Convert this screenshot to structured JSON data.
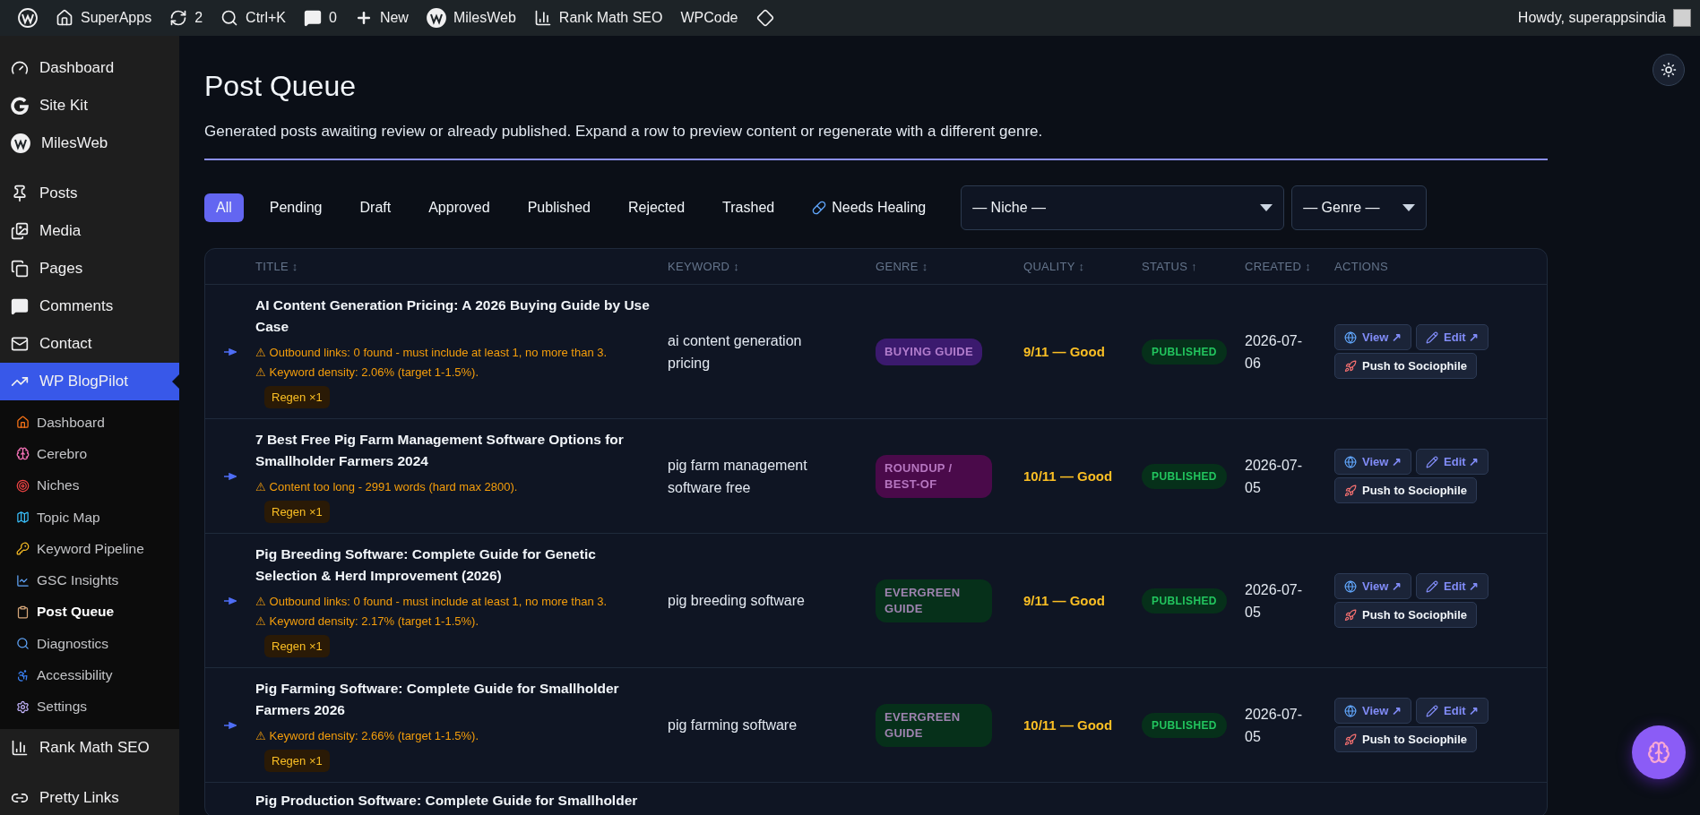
{
  "admin_bar": {
    "items": [
      {
        "kind": "wp"
      },
      {
        "kind": "home",
        "label": "SuperApps"
      },
      {
        "kind": "updates",
        "label": "2"
      },
      {
        "kind": "search",
        "label": "Ctrl+K"
      },
      {
        "kind": "comments",
        "label": "0"
      },
      {
        "kind": "new",
        "label": "New"
      },
      {
        "kind": "milesweb",
        "label": "MilesWeb"
      },
      {
        "kind": "rankmath",
        "label": "Rank Math SEO"
      },
      {
        "kind": "text",
        "label": "WPCode"
      },
      {
        "kind": "diamond"
      }
    ],
    "greeting": "Howdy, superappsindia"
  },
  "sidebar": {
    "groups": [
      [
        {
          "kind": "dashboard",
          "label": "Dashboard",
          "selected": false
        },
        {
          "kind": "sitekit",
          "label": "Site Kit",
          "selected": false
        },
        {
          "kind": "milesweb",
          "label": "MilesWeb",
          "selected": false
        }
      ],
      [
        {
          "kind": "posts",
          "label": "Posts",
          "selected": false
        },
        {
          "kind": "media",
          "label": "Media",
          "selected": false
        },
        {
          "kind": "pages",
          "label": "Pages",
          "selected": false
        },
        {
          "kind": "comments",
          "label": "Comments",
          "selected": false
        },
        {
          "kind": "contact",
          "label": "Contact",
          "selected": false
        },
        {
          "kind": "blogpilot",
          "label": "WP BlogPilot",
          "selected": true,
          "submenu": [
            {
              "kind": "home",
              "label": "Dashboard",
              "selected": false
            },
            {
              "kind": "brain",
              "label": "Cerebro",
              "selected": false
            },
            {
              "kind": "target",
              "label": "Niches",
              "selected": false
            },
            {
              "kind": "map",
              "label": "Topic Map",
              "selected": false
            },
            {
              "kind": "key",
              "label": "Keyword Pipeline",
              "selected": false
            },
            {
              "kind": "chart",
              "label": "GSC Insights",
              "selected": false
            },
            {
              "kind": "clipboard",
              "label": "Post Queue",
              "selected": true
            },
            {
              "kind": "search",
              "label": "Diagnostics",
              "selected": false
            },
            {
              "kind": "accessibility",
              "label": "Accessibility",
              "selected": false
            },
            {
              "kind": "settings",
              "label": "Settings",
              "selected": false
            }
          ]
        },
        {
          "kind": "rankmath",
          "label": "Rank Math SEO",
          "selected": false
        }
      ],
      [
        {
          "kind": "prettylinks",
          "label": "Pretty Links",
          "selected": false
        }
      ]
    ]
  },
  "page": {
    "title": "Post Queue",
    "description": "Generated posts awaiting review or already published. Expand a row to preview content or regenerate with a different genre."
  },
  "filters": [
    {
      "kind": "plain",
      "label": "All",
      "selected": true
    },
    {
      "kind": "plain",
      "label": "Pending",
      "selected": false
    },
    {
      "kind": "plain",
      "label": "Draft",
      "selected": false
    },
    {
      "kind": "plain",
      "label": "Approved",
      "selected": false
    },
    {
      "kind": "plain",
      "label": "Published",
      "selected": false
    },
    {
      "kind": "plain",
      "label": "Rejected",
      "selected": false
    },
    {
      "kind": "plain",
      "label": "Trashed",
      "selected": false
    },
    {
      "kind": "healing",
      "label": "Needs Healing",
      "selected": false
    }
  ],
  "selects": [
    {
      "kind": "wide",
      "value": "— Niche —"
    },
    {
      "kind": "narrow",
      "value": "— Genre —"
    }
  ],
  "table": {
    "columns": [
      {
        "label": "TITLE",
        "sort": "↕"
      },
      {
        "label": "KEYWORD",
        "sort": "↕"
      },
      {
        "label": "GENRE",
        "sort": "↕"
      },
      {
        "label": "QUALITY",
        "sort": "↕"
      },
      {
        "label": "STATUS",
        "sort": "↑"
      },
      {
        "label": "CREATED",
        "sort": "↕"
      },
      {
        "label": "ACTIONS"
      }
    ],
    "rows": [
      {
        "kind": "full",
        "title": "AI Content Generation Pricing: A 2026 Buying Guide by Use Case",
        "warnings": [
          "⚠ Outbound links: 0 found - must include at least 1, no more than 3.",
          "⚠ Keyword density: 2.06% (target 1-1.5%)."
        ],
        "regen": "Regen ×1",
        "keyword": "ai content generation pricing",
        "genre": {
          "label": "BUYING GUIDE",
          "color": "#3b1a6e"
        },
        "quality": "9/11 — Good",
        "status": "PUBLISHED",
        "created": "2026-07-06",
        "actions": [
          {
            "kind": "view",
            "label": "View ↗"
          },
          {
            "kind": "edit",
            "label": "Edit ↗"
          },
          {
            "kind": "push",
            "label": "Push to Sociophile"
          }
        ]
      },
      {
        "kind": "full",
        "title": "7 Best Free Pig Farm Management Software Options for Smallholder Farmers 2024",
        "warnings": [
          "⚠ Content too long - 2991 words (hard max 2800)."
        ],
        "regen": "Regen ×1",
        "keyword": "pig farm management software free",
        "genre": {
          "label": "ROUNDUP / BEST-OF",
          "color": "#4a0a4a"
        },
        "quality": "10/11 — Good",
        "status": "PUBLISHED",
        "created": "2026-07-05",
        "actions": [
          {
            "kind": "view",
            "label": "View ↗"
          },
          {
            "kind": "edit",
            "label": "Edit ↗"
          },
          {
            "kind": "push",
            "label": "Push to Sociophile"
          }
        ]
      },
      {
        "kind": "full",
        "title": "Pig Breeding Software: Complete Guide for Genetic Selection & Herd Improvement (2026)",
        "warnings": [
          "⚠ Outbound links: 0 found - must include at least 1, no more than 3.",
          "⚠ Keyword density: 2.17% (target 1-1.5%)."
        ],
        "regen": "Regen ×1",
        "keyword": "pig breeding software",
        "genre": {
          "label": "EVERGREEN GUIDE",
          "color": "#06301a"
        },
        "quality": "9/11 — Good",
        "status": "PUBLISHED",
        "created": "2026-07-05",
        "actions": [
          {
            "kind": "view",
            "label": "View ↗"
          },
          {
            "kind": "edit",
            "label": "Edit ↗"
          },
          {
            "kind": "push",
            "label": "Push to Sociophile"
          }
        ]
      },
      {
        "kind": "full",
        "title": "Pig Farming Software: Complete Guide for Smallholder Farmers 2026",
        "warnings": [
          "⚠ Keyword density: 2.66% (target 1-1.5%)."
        ],
        "regen": "Regen ×1",
        "keyword": "pig farming software",
        "genre": {
          "label": "EVERGREEN GUIDE",
          "color": "#06301a"
        },
        "quality": "10/11 — Good",
        "status": "PUBLISHED",
        "created": "2026-07-05",
        "actions": [
          {
            "kind": "view",
            "label": "View ↗"
          },
          {
            "kind": "edit",
            "label": "Edit ↗"
          },
          {
            "kind": "push",
            "label": "Push to Sociophile"
          }
        ]
      },
      {
        "kind": "partial",
        "title": "Pig Production Software: Complete Guide for Smallholder"
      }
    ]
  }
}
